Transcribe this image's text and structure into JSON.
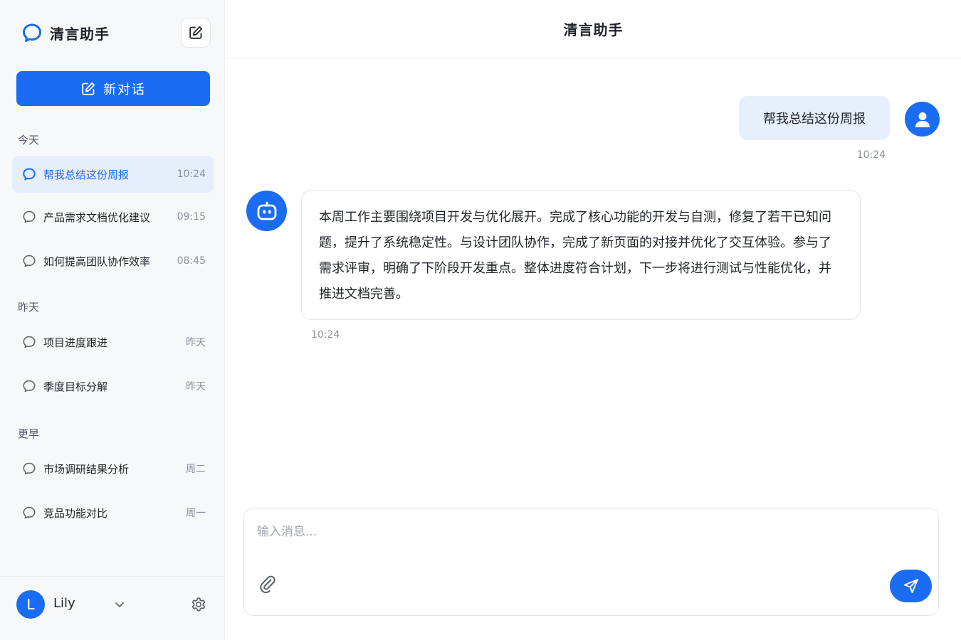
{
  "app": {
    "name": "清言助手"
  },
  "sidebar": {
    "new_chat_label": "新对话",
    "groups": [
      {
        "label": "今天",
        "items": [
          {
            "title": "帮我总结这份周报",
            "time": "10:24",
            "active": true
          },
          {
            "title": "产品需求文档优化建议",
            "time": "09:15"
          },
          {
            "title": "如何提高团队协作效率",
            "time": "08:45"
          }
        ]
      },
      {
        "label": "昨天",
        "items": [
          {
            "title": "项目进度跟进",
            "time": "昨天"
          },
          {
            "title": "季度目标分解",
            "time": "昨天"
          }
        ]
      },
      {
        "label": "更早",
        "items": [
          {
            "title": "市场调研结果分析",
            "time": "周二"
          },
          {
            "title": "竞品功能对比",
            "time": "周一"
          }
        ]
      }
    ],
    "user": {
      "initial": "L",
      "name": "Lily"
    }
  },
  "header": {
    "title": "清言助手"
  },
  "messages": [
    {
      "role": "user",
      "text": "帮我总结这份周报",
      "time": "10:24"
    },
    {
      "role": "assistant",
      "text": "本周工作主要围绕项目开发与优化展开。完成了核心功能的开发与自测，修复了若干已知问题，提升了系统稳定性。与设计团队协作，完成了新页面的对接并优化了交互体验。参与了需求评审，明确了下阶段开发重点。整体进度符合计划，下一步将进行测试与性能优化，并推进文档完善。",
      "time": "10:24"
    }
  ],
  "composer": {
    "placeholder": "输入消息...",
    "value": ""
  },
  "icons": {
    "brand": "chat-bubble-logo-icon",
    "compose": "edit-square-icon",
    "conversation": "chat-bubble-icon",
    "user_menu": "chevron-down-icon",
    "settings": "gear-icon",
    "user_avatar": "person-icon",
    "bot_avatar": "robot-icon",
    "attach": "paperclip-icon",
    "send": "paper-plane-icon"
  },
  "colors": {
    "accent": "#1a6cf2",
    "active_bg": "#e6eefc",
    "user_bubble": "#e8effc"
  }
}
